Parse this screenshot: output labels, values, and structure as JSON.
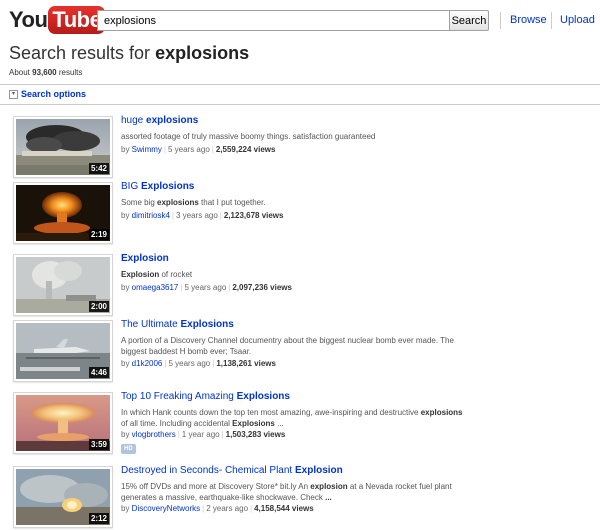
{
  "header": {
    "logo_you": "You",
    "logo_tube": "Tube",
    "search_value": "explosions",
    "search_button": "Search",
    "browse": "Browse",
    "upload": "Upload"
  },
  "page": {
    "title_prefix": "Search results for ",
    "title_query": "explosions",
    "count_prefix": "About ",
    "count_value": "93,600",
    "count_suffix": " results",
    "search_options": "Search options"
  },
  "results": [
    {
      "title_pre": "huge ",
      "title_bold": "explosions",
      "title_post": "",
      "desc": [
        {
          "t": "assorted footage of truly massive boomy things. satisfaction guaranteed",
          "b": false
        }
      ],
      "desc2": [],
      "by": "by ",
      "user": "Swimmy",
      "age": "5 years ago",
      "views": "2,559,224 views",
      "duration": "5:42",
      "hd": ""
    },
    {
      "title_pre": "BIG ",
      "title_bold": "Explosions",
      "title_post": "",
      "desc": [
        {
          "t": "Some big ",
          "b": false
        },
        {
          "t": "explosions",
          "b": true
        },
        {
          "t": " that I put together.",
          "b": false
        }
      ],
      "desc2": [],
      "by": "by ",
      "user": "dimitriosk4",
      "age": "3 years ago",
      "views": "2,123,678 views",
      "duration": "2:19",
      "hd": ""
    },
    {
      "title_pre": "",
      "title_bold": "Explosion",
      "title_post": "",
      "desc": [
        {
          "t": "Explosion",
          "b": true
        },
        {
          "t": " of rocket",
          "b": false
        }
      ],
      "desc2": [],
      "by": "by ",
      "user": "omaega3617",
      "age": "5 years ago",
      "views": "2,097,236 views",
      "duration": "2:00",
      "hd": ""
    },
    {
      "title_pre": "The Ultimate ",
      "title_bold": "Explosions",
      "title_post": "",
      "desc": [
        {
          "t": "A portion of a Discovery Channel documentry about the biggest nuclear bomb ever made. The",
          "b": false
        }
      ],
      "desc2": [
        {
          "t": "biggest baddest H bomb ever; Tsaar.",
          "b": false
        }
      ],
      "by": "by ",
      "user": "d1k2006",
      "age": "5 years ago",
      "views": "1,138,261 views",
      "duration": "4:46",
      "hd": ""
    },
    {
      "title_pre": "Top 10 Freaking Amazing ",
      "title_bold": "Explosions",
      "title_post": "",
      "desc": [
        {
          "t": "In which Hank counts down the top ten most amazing, awe-inspiring and destructive ",
          "b": false
        },
        {
          "t": "explosions",
          "b": true
        }
      ],
      "desc2": [
        {
          "t": "of all time. Including accidental ",
          "b": false
        },
        {
          "t": "Explosions",
          "b": true
        },
        {
          "t": " ...",
          "b": false
        }
      ],
      "by": "by ",
      "user": "vlogbrothers",
      "age": "1 year ago",
      "views": "1,503,283 views",
      "duration": "3:59",
      "hd": "HD"
    },
    {
      "title_pre": "Destroyed in Seconds- Chemical Plant ",
      "title_bold": "Explosion",
      "title_post": "",
      "desc": [
        {
          "t": "15% off DVDs and more at Discovery Store* bit.ly An ",
          "b": false
        },
        {
          "t": "explosion",
          "b": true
        },
        {
          "t": " at a Nevada rocket fuel plant",
          "b": false
        }
      ],
      "desc2": [
        {
          "t": "generates a massive, earthquake-like shockwave. Check ",
          "b": false
        },
        {
          "t": "...",
          "b": true
        }
      ],
      "by": "by ",
      "user": "DiscoveryNetworks",
      "age": "2 years ago",
      "views": "4,158,544 views",
      "duration": "2:12",
      "hd": ""
    }
  ]
}
